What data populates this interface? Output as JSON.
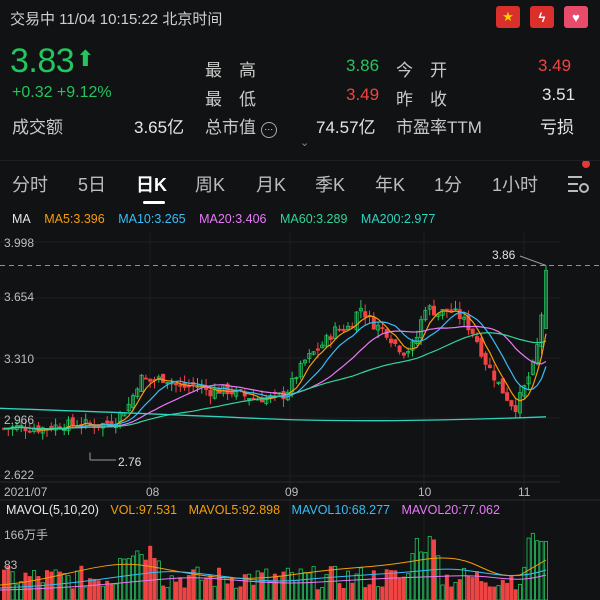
{
  "header": {
    "status_text": "交易中 11/04 10:15:22 北京时间",
    "icons": [
      "china-flag-icon",
      "flash-icon",
      "heart-icon"
    ],
    "price": "3.83",
    "change": "+0.32  +9.12%",
    "turnover_label": "成交额",
    "turnover_value": "3.65亿",
    "high_label": "最　高",
    "high_value": "3.86",
    "low_label": "最　低",
    "low_value": "3.49",
    "mktcap_label": "总市值",
    "mktcap_value": "74.57亿",
    "open_label": "今　开",
    "open_value": "3.49",
    "prevclose_label": "昨　收",
    "prevclose_value": "3.51",
    "pe_label": "市盈率TTM",
    "pe_value": "亏损"
  },
  "tabs": [
    "分时",
    "5日",
    "日K",
    "周K",
    "月K",
    "季K",
    "年K",
    "1分",
    "1小时"
  ],
  "active_tab": "日K",
  "ma_legend": {
    "title": "MA",
    "ma5": "MA5:3.396",
    "ma10": "MA10:3.265",
    "ma20": "MA20:3.406",
    "ma60": "MA60:3.289",
    "ma200": "MA200:2.977"
  },
  "vol_legend": {
    "title": "MAVOL(5,10,20)",
    "vol": "VOL:97.531",
    "mavol5": "MAVOL5:92.898",
    "mavol10": "MAVOL10:68.277",
    "mavol20": "MAVOL20:77.062"
  },
  "chart_labels": {
    "y_ticks": [
      "3.998",
      "3.654",
      "3.310",
      "2.966",
      "2.622"
    ],
    "x_ticks": [
      "2021/07",
      "08",
      "09",
      "10",
      "11"
    ],
    "max_marker": "3.86",
    "min_marker": "2.76",
    "vol_y_ticks": [
      "166万手",
      "83"
    ]
  },
  "colors": {
    "up": "#22c55e",
    "down": "#ef4444",
    "ma5": "#f59e0b",
    "ma10": "#38bdf8",
    "ma20": "#e879f9",
    "ma60": "#34d399",
    "ma200": "#2dd4bf"
  },
  "chart_data": {
    "type": "candlestick",
    "y_range": [
      2.622,
      3.998
    ],
    "last_close": 3.83,
    "period_high": 3.86,
    "period_low": 2.76
  }
}
